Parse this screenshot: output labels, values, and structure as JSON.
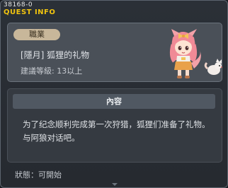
{
  "header": {
    "quest_id": "38168-0",
    "title": "QUEST INFO"
  },
  "quest": {
    "job_badge": "職業",
    "title": "[隱月] 狐狸的礼物",
    "level_requirement": "建議等級: 13以上",
    "npc_icon": "fox-girl-npc-icon"
  },
  "content": {
    "header": "內容",
    "text": "为了纪念顺利完成第一次狩猎，狐狸们准备了礼物。与阿狼对话吧。"
  },
  "footer": {
    "status": "狀態：可開始"
  }
}
